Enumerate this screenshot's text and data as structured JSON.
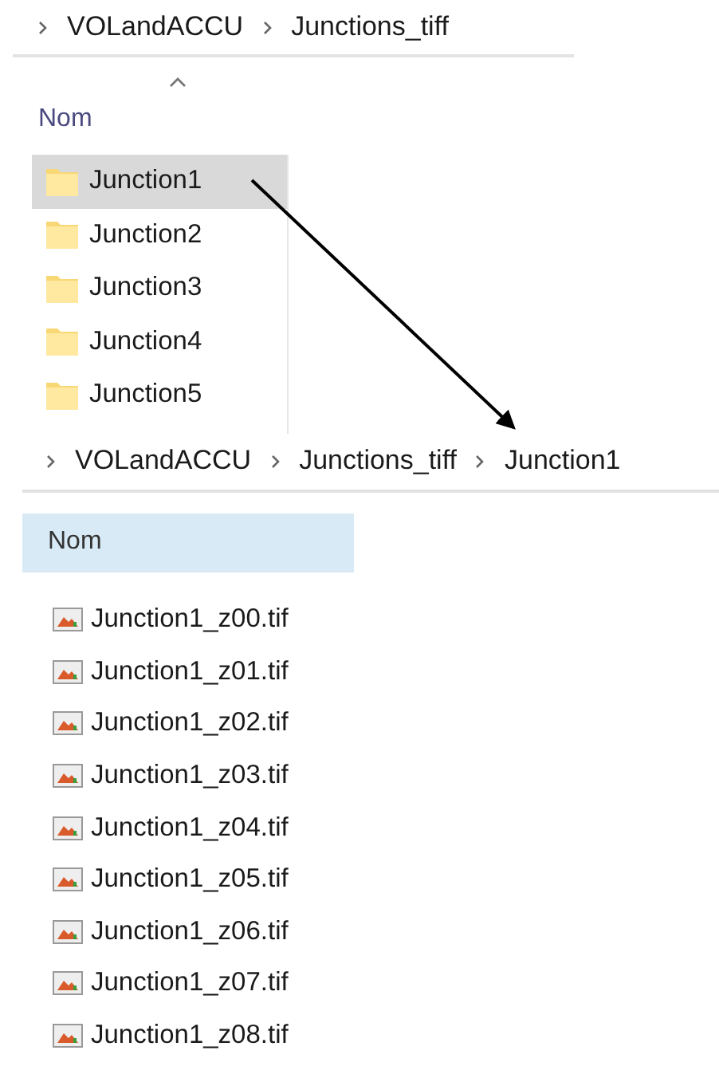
{
  "panes": [
    {
      "breadcrumb": [
        "VOLandACCU",
        "Junctions_tiff"
      ],
      "column": "Nom",
      "sorted": true,
      "highlighted": false,
      "items": [
        {
          "name": "Junction1",
          "kind": "folder",
          "selected": true
        },
        {
          "name": "Junction2",
          "kind": "folder",
          "selected": false
        },
        {
          "name": "Junction3",
          "kind": "folder",
          "selected": false
        },
        {
          "name": "Junction4",
          "kind": "folder",
          "selected": false
        },
        {
          "name": "Junction5",
          "kind": "folder",
          "selected": false
        }
      ]
    },
    {
      "breadcrumb": [
        "VOLandACCU",
        "Junctions_tiff",
        "Junction1"
      ],
      "column": "Nom",
      "sorted": false,
      "highlighted": true,
      "items": [
        {
          "name": "Junction1_z00.tif",
          "kind": "image",
          "selected": false
        },
        {
          "name": "Junction1_z01.tif",
          "kind": "image",
          "selected": false
        },
        {
          "name": "Junction1_z02.tif",
          "kind": "image",
          "selected": false
        },
        {
          "name": "Junction1_z03.tif",
          "kind": "image",
          "selected": false
        },
        {
          "name": "Junction1_z04.tif",
          "kind": "image",
          "selected": false
        },
        {
          "name": "Junction1_z05.tif",
          "kind": "image",
          "selected": false
        },
        {
          "name": "Junction1_z06.tif",
          "kind": "image",
          "selected": false
        },
        {
          "name": "Junction1_z07.tif",
          "kind": "image",
          "selected": false
        },
        {
          "name": "Junction1_z08.tif",
          "kind": "image",
          "selected": false
        }
      ]
    }
  ]
}
